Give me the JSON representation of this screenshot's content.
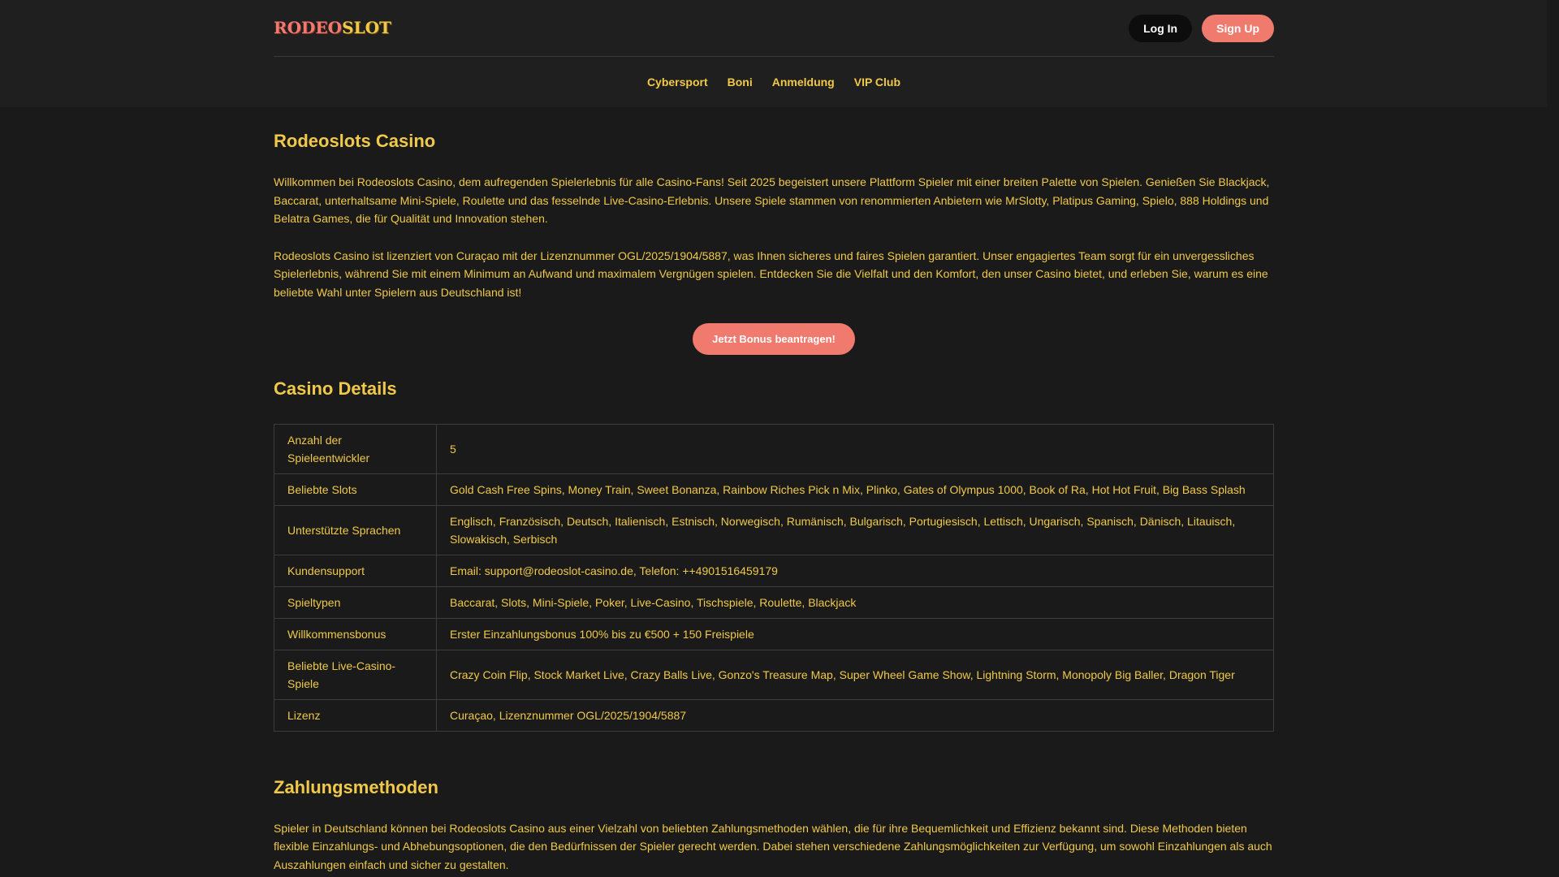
{
  "header": {
    "logo": {
      "part1": "RODEO",
      "part2": "SLOT"
    },
    "login_label": "Log In",
    "signup_label": "Sign Up",
    "nav": [
      "Cybersport",
      "Boni",
      "Anmeldung",
      "VIP Club"
    ]
  },
  "main": {
    "title": "Rodeoslots Casino",
    "intro_1": "Willkommen bei Rodeoslots Casino, dem aufregenden Spielerlebnis für alle Casino-Fans! Seit 2025 begeistert unsere Plattform Spieler mit einer breiten Palette von Spielen. Genießen Sie Blackjack, Baccarat, unterhaltsame Mini-Spiele, Roulette und das fesselnde Live-Casino-Erlebnis. Unsere Spiele stammen von renommierten Anbietern wie MrSlotty, Platipus Gaming, Spielo, 888 Holdings und Belatra Games, die für Qualität und Innovation stehen.",
    "intro_2": "Rodeoslots Casino ist lizenziert von Curaçao mit der Lizenznummer OGL/2025/1904/5887, was Ihnen sicheres und faires Spielen garantiert. Unser engagiertes Team sorgt für ein unvergessliches Spielerlebnis, während Sie mit einem Minimum an Aufwand und maximalem Vergnügen spielen. Entdecken Sie die Vielfalt und den Komfort, den unser Casino bietet, und erleben Sie, warum es eine beliebte Wahl unter Spielern aus Deutschland ist!",
    "cta_label": "Jetzt Bonus beantragen!",
    "details_title": "Casino Details",
    "details": [
      {
        "key": "Anzahl der Spieleentwickler",
        "value": "5"
      },
      {
        "key": "Beliebte Slots",
        "value": "Gold Cash Free Spins, Money Train, Sweet Bonanza, Rainbow Riches Pick n Mix, Plinko, Gates of Olympus 1000, Book of Ra, Hot Hot Fruit, Big Bass Splash"
      },
      {
        "key": "Unterstützte Sprachen",
        "value": "Englisch, Französisch, Deutsch, Italienisch, Estnisch, Norwegisch, Rumänisch, Bulgarisch, Portugiesisch, Lettisch, Ungarisch, Spanisch, Dänisch, Litauisch, Slowakisch, Serbisch"
      },
      {
        "key": "Kundensupport",
        "value": "Email: support@rodeoslot-casino.de, Telefon: ++4901516459179"
      },
      {
        "key": "Spieltypen",
        "value": "Baccarat, Slots, Mini-Spiele, Poker, Live-Casino, Tischspiele, Roulette, Blackjack"
      },
      {
        "key": "Willkommensbonus",
        "value": "Erster Einzahlungsbonus 100% bis zu €500 + 150 Freispiele"
      },
      {
        "key": "Beliebte Live-Casino-Spiele",
        "value": "Crazy Coin Flip, Stock Market Live, Crazy Balls Live, Gonzo's Treasure Map, Super Wheel Game Show, Lightning Storm, Monopoly Big Baller, Dragon Tiger"
      },
      {
        "key": "Lizenz",
        "value": "Curaçao, Lizenznummer OGL/2025/1904/5887"
      }
    ],
    "payments_title": "Zahlungsmethoden",
    "payments_text": "Spieler in Deutschland können bei Rodeoslots Casino aus einer Vielzahl von beliebten Zahlungsmethoden wählen, die für ihre Bequemlichkeit und Effizienz bekannt sind. Diese Methoden bieten flexible Einzahlungs- und Abhebungsoptionen, die den Bedürfnissen der Spieler gerecht werden. Dabei stehen verschiedene Zahlungsmöglichkeiten zur Verfügung, um sowohl Einzahlungen als auch Auszahlungen einfach und sicher zu gestalten."
  },
  "colors": {
    "background": "#1a1a1a",
    "header_background": "#1f1f1f",
    "text_gold": "#f0c94a",
    "accent_coral": "#f07a6e",
    "login_button": "#0d0d0d"
  }
}
